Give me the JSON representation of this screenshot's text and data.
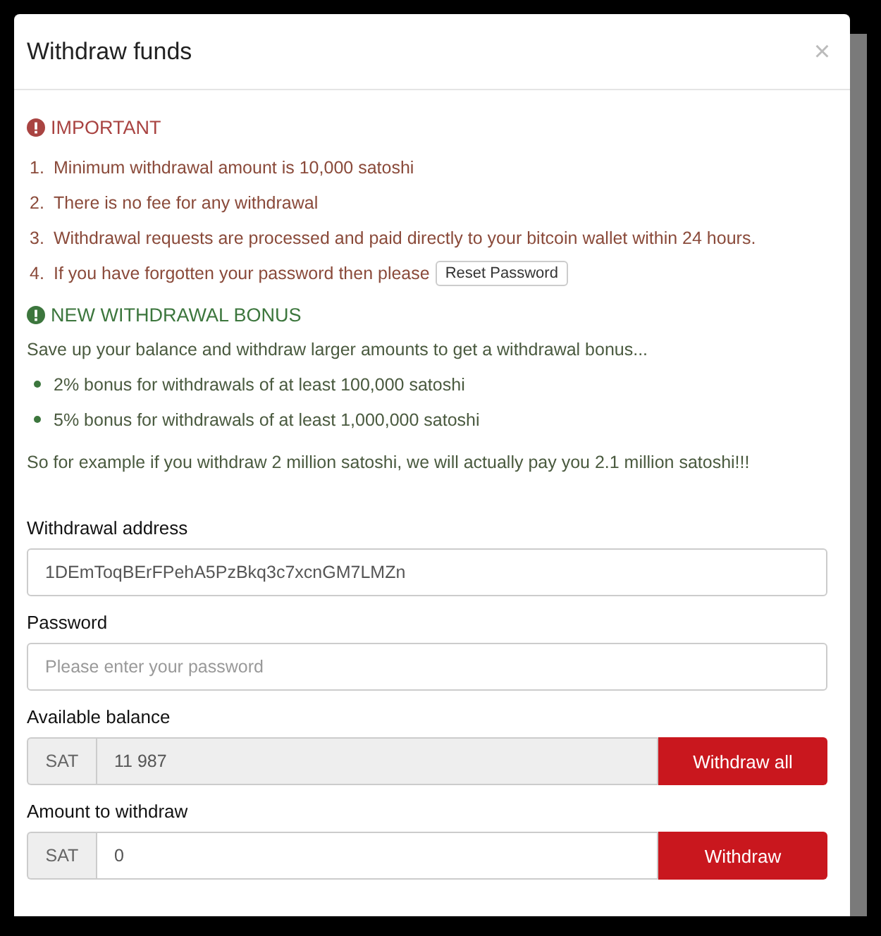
{
  "modal": {
    "title": "Withdraw funds",
    "close": "×"
  },
  "important": {
    "heading": "IMPORTANT",
    "items": [
      {
        "number": "1.",
        "text": "Minimum withdrawal amount is 10,000 satoshi"
      },
      {
        "number": "2.",
        "text": "There is no fee for any withdrawal"
      },
      {
        "number": "3.",
        "text": "Withdrawal requests are processed and paid directly to your bitcoin wallet within 24 hours."
      },
      {
        "number": "4.",
        "text": "If you have forgotten your password then please",
        "button": "Reset Password"
      }
    ]
  },
  "bonus": {
    "heading": "NEW WITHDRAWAL BONUS",
    "intro": "Save up your balance and withdraw larger amounts to get a withdrawal bonus...",
    "bullets": [
      "2% bonus for withdrawals of at least 100,000 satoshi",
      "5% bonus for withdrawals of at least 1,000,000 satoshi"
    ],
    "example": "So for example if you withdraw 2 million satoshi, we will actually pay you 2.1 million satoshi!!!"
  },
  "form": {
    "address": {
      "label": "Withdrawal address",
      "value": "1DEmToqBErFPehA5PzBkq3c7xcnGM7LMZn"
    },
    "password": {
      "label": "Password",
      "placeholder": "Please enter your password"
    },
    "amounts": [
      {
        "label": "Available balance",
        "prefix": "SAT",
        "value": "11 987",
        "disabled": true,
        "button": "Withdraw all"
      },
      {
        "label": "Amount to withdraw",
        "prefix": "SAT",
        "value": "0",
        "disabled": false,
        "button": "Withdraw"
      }
    ]
  }
}
